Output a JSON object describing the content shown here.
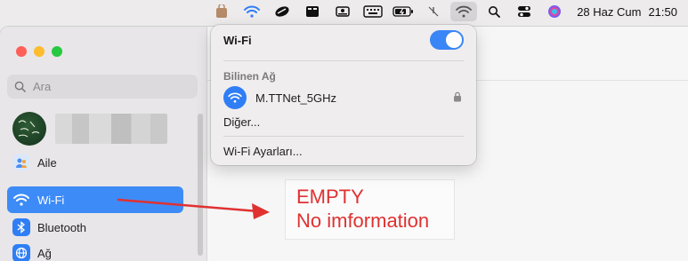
{
  "menubar": {
    "icons": [
      "finder-bag-icon",
      "wifi-status-icon",
      "pen-icon",
      "dashboard-icon",
      "disk-icon",
      "keyboard-icon",
      "battery-icon",
      "mic-off-icon",
      "wifi-icon",
      "search-icon",
      "control-center-icon",
      "siri-icon"
    ],
    "date": "28 Haz Cum",
    "time": "21:50"
  },
  "sidebar": {
    "search_placeholder": "Ara",
    "items": [
      {
        "label": "Aile"
      },
      {
        "label": "Wi-Fi"
      },
      {
        "label": "Bluetooth"
      },
      {
        "label": "Ağ"
      }
    ]
  },
  "wifi_menu": {
    "title": "Wi-Fi",
    "enabled": true,
    "known_networks_label": "Bilinen Ağ",
    "network_name": "M.TTNet_5GHz",
    "other": "Diğer...",
    "settings": "Wi-Fi Ayarları..."
  },
  "annotation": {
    "line1": "EMPTY",
    "line2": "No imformation"
  },
  "colors": {
    "accent": "#3d8bf7",
    "annotation": "#e03131"
  }
}
